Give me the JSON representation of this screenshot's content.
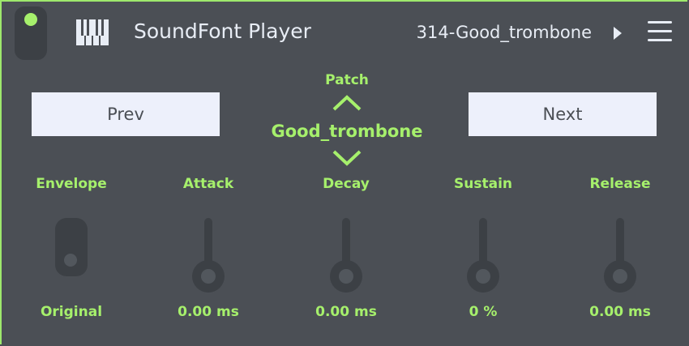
{
  "header": {
    "title": "SoundFont Player",
    "current_patch": "314-Good_trombone"
  },
  "controls": {
    "prev_label": "Prev",
    "next_label": "Next",
    "patch_label": "Patch",
    "patch_value": "Good_trombone"
  },
  "envelope": {
    "label": "Envelope",
    "value": "Original"
  },
  "attack": {
    "label": "Attack",
    "value": "0.00 ms",
    "level": 0
  },
  "decay": {
    "label": "Decay",
    "value": "0.00 ms",
    "level": 0
  },
  "sustain": {
    "label": "Sustain",
    "value": "0 %",
    "level": 0
  },
  "release": {
    "label": "Release",
    "value": "0.00 ms",
    "level": 0
  },
  "colors": {
    "background": "#4b4f55",
    "accent": "#a6f06c",
    "button_bg": "#edf0fb",
    "control_dark": "#3c4045"
  },
  "icons": [
    "power-indicator-icon",
    "piano-keys-icon",
    "play-icon",
    "hamburger-menu-icon",
    "chevron-up-icon",
    "chevron-down-icon"
  ]
}
